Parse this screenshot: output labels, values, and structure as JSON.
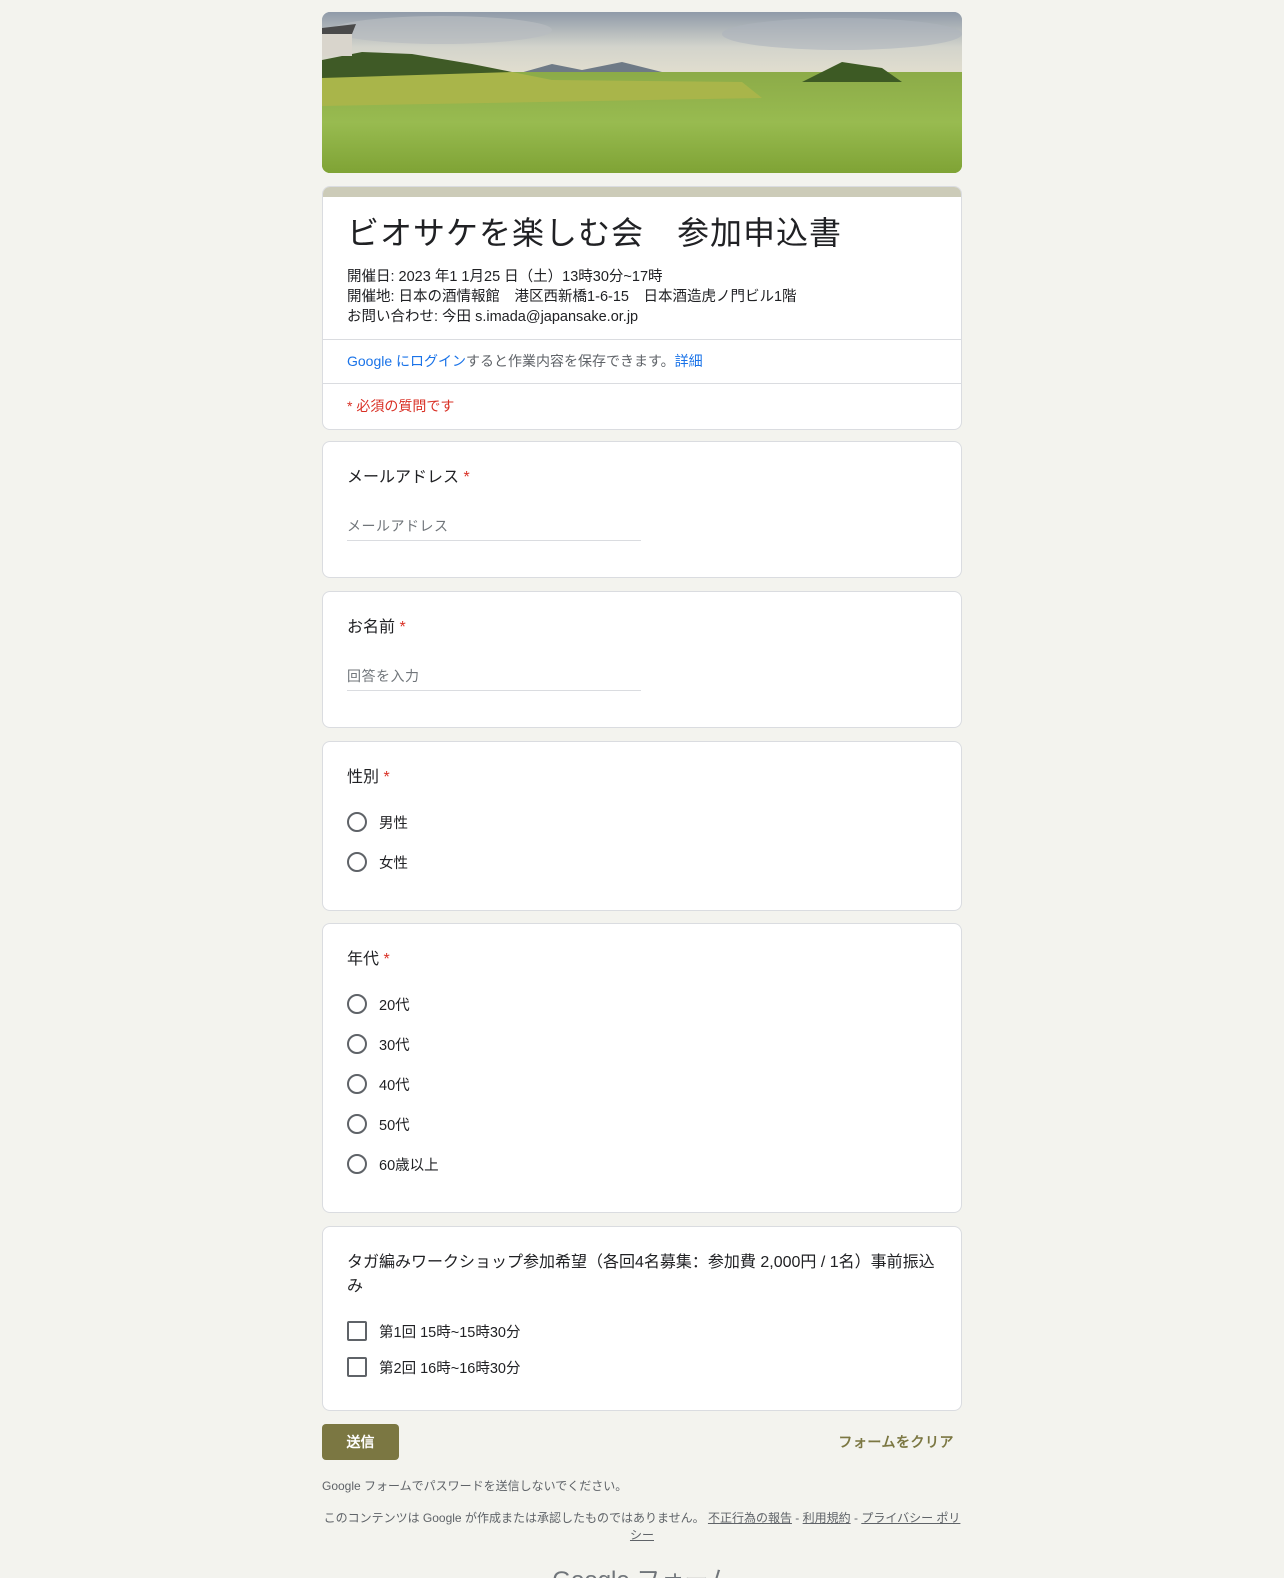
{
  "form": {
    "title": "ビオサケを楽しむ会　参加申込書",
    "description": [
      "開催日: 2023 年1 1月25 日（土）13時30分~17時",
      "開催地: 日本の酒情報館　港区西新橋1-6-15　日本酒造虎ノ門ビル1階",
      "お問い合わせ:  今田 s.imada@japansake.or.jp"
    ],
    "login_link": "Google にログイン",
    "login_text": "すると作業内容を保存できます。",
    "details_link": "詳細",
    "required_note": "* 必須の質問です"
  },
  "questions": {
    "email": {
      "title": "メールアドレス",
      "required": "*",
      "placeholder": "メールアドレス"
    },
    "name": {
      "title": "お名前",
      "required": "*",
      "placeholder": "回答を入力"
    },
    "gender": {
      "title": "性別",
      "required": "*",
      "options": [
        "男性",
        "女性"
      ]
    },
    "age": {
      "title": "年代",
      "required": "*",
      "options": [
        "20代",
        "30代",
        "40代",
        "50代",
        "60歳以上"
      ]
    },
    "workshop": {
      "title": "タガ編みワークショップ参加希望（各回4名募集：参加費 2,000円 / 1名）事前振込み",
      "options": [
        "第1回 15時~15時30分",
        "第2回 16時~16時30分"
      ]
    }
  },
  "actions": {
    "submit": "送信",
    "clear": "フォームをクリア"
  },
  "footer": {
    "password_note": "Google フォームでパスワードを送信しないでください。",
    "disclaimer": "このコンテンツは Google が作成または承認したものではありません。",
    "report": "不正行為の報告",
    "terms": "利用規約",
    "privacy": "プライバシー ポリシー",
    "dash": " - ",
    "logo": "Google フォーム"
  },
  "theme": {
    "accent": "#7b7742",
    "header_bar": "#cccbb8",
    "required": "#d93025",
    "background": "#f3f3ee"
  }
}
